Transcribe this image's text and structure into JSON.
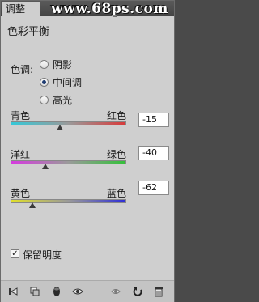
{
  "watermark": "www.68ps.com",
  "tab_label": "调整",
  "panel_title": "色彩平衡",
  "tone": {
    "label": "色调:",
    "options": [
      "阴影",
      "中间调",
      "高光"
    ],
    "selected": "中间调"
  },
  "sliders": [
    {
      "left_label": "青色",
      "right_label": "红色",
      "value": "-15",
      "gradient_from": "#35c8d8",
      "gradient_to": "#d83a3a"
    },
    {
      "left_label": "洋红",
      "right_label": "绿色",
      "value": "-40",
      "gradient_from": "#d63adf",
      "gradient_to": "#34c13a"
    },
    {
      "left_label": "黄色",
      "right_label": "蓝色",
      "value": "-62",
      "gradient_from": "#e0df2a",
      "gradient_to": "#2f2fd6"
    }
  ],
  "preserve_luminosity": {
    "label": "保留明度",
    "checked": true
  },
  "bottom_icons": [
    "back-arrow-icon",
    "clip-layer-icon",
    "visibility-eye-icon",
    "visibility-eye-icon-2",
    "view-previous-icon",
    "reset-icon",
    "trash-icon"
  ]
}
